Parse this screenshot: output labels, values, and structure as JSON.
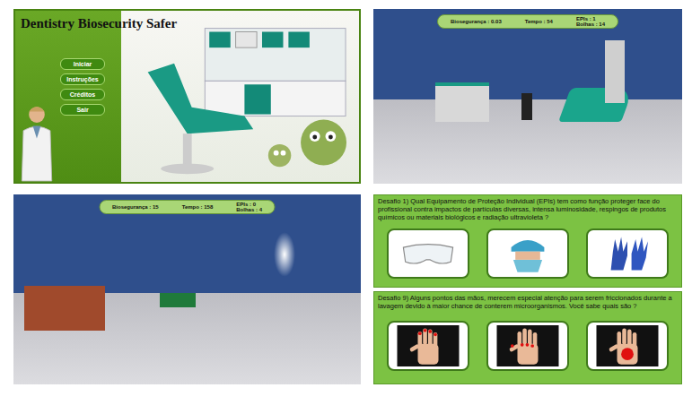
{
  "title_screen": {
    "title": "Dentistry Biosecurity Safer",
    "menu": [
      {
        "label": "Iniciar"
      },
      {
        "label": "Instruções"
      },
      {
        "label": "Créditos"
      },
      {
        "label": "Sair"
      }
    ]
  },
  "scenes": [
    {
      "kind": "clinic",
      "hud": {
        "biosecurity": "Biosegurança : 0.03",
        "time": "Tempo : 54",
        "epis": "EPIs : 1",
        "bubbles": "Bolhas : 14"
      }
    },
    {
      "kind": "reception",
      "hud": {
        "biosecurity": "Biosegurança : 15",
        "time": "Tempo : 158",
        "epis": "EPIs : 0",
        "bubbles": "Bolhas : 4"
      }
    }
  ],
  "challenges": [
    {
      "question": "Desafio 1) Qual Equipamento de Proteção Individual (EPIs) tem como função proteger face do profissional contra  impactos de partículas diversas, intensa luminosidade, respingos de produtos químicos ou materiais biológicos e radiação ultravioleta ?",
      "options": [
        {
          "kind": "goggles"
        },
        {
          "kind": "mask"
        },
        {
          "kind": "gloves"
        }
      ]
    },
    {
      "question": "Desafio 9) Alguns pontos das mãos, merecem especial atenção para serem friccionados durante a lavagem devido à maior chance de conterem microorganismos. Você sabe quais são ?",
      "options": [
        {
          "kind": "hand-fingertips"
        },
        {
          "kind": "hand-spots"
        },
        {
          "kind": "hand-palm"
        }
      ]
    }
  ]
}
